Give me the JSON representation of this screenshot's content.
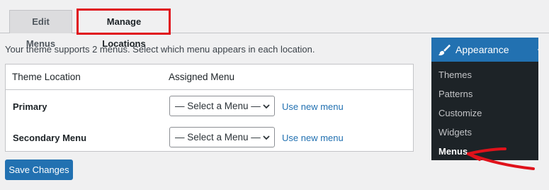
{
  "tabs": {
    "edit_menus": "Edit Menus",
    "manage_locations": "Manage Locations"
  },
  "intro_text": "Your theme supports 2 menus. Select which menu appears in each location.",
  "table": {
    "headers": [
      "Theme Location",
      "Assigned Menu"
    ],
    "rows": [
      {
        "location": "Primary",
        "selected": "— Select a Menu —",
        "link": "Use new menu"
      },
      {
        "location": "Secondary Menu",
        "selected": "— Select a Menu —",
        "link": "Use new menu"
      }
    ]
  },
  "save_button": "Save Changes",
  "admin_menu": {
    "heading": "Appearance",
    "items": [
      "Themes",
      "Patterns",
      "Customize",
      "Widgets",
      "Menus"
    ],
    "current": "Menus"
  },
  "colors": {
    "accent": "#2271b1",
    "highlight_annotation": "#e0121b",
    "admin_bg": "#1d2327"
  },
  "icons": {
    "appearance": "paintbrush-icon",
    "select": "chevron-down-icon"
  }
}
